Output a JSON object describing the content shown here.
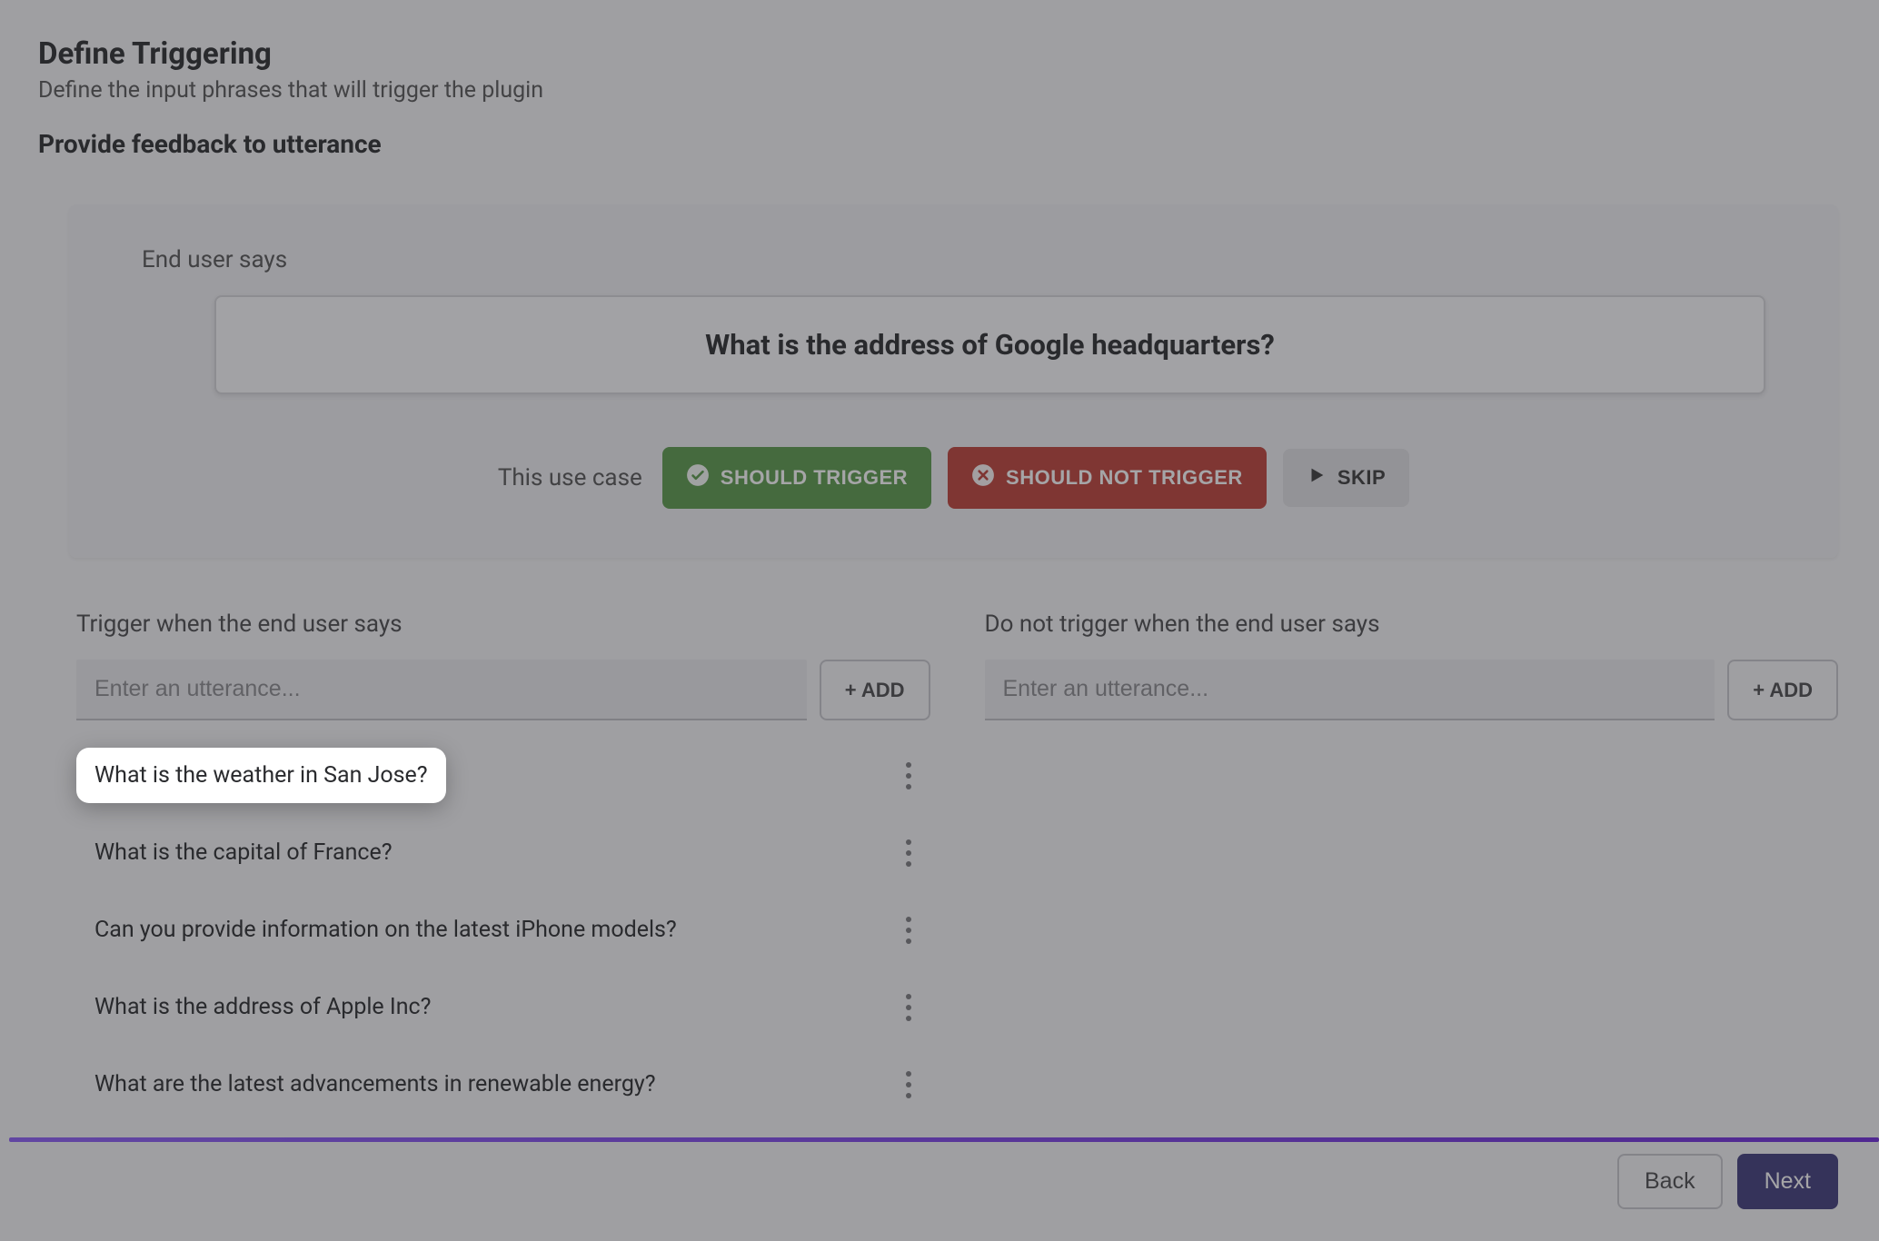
{
  "header": {
    "title": "Define Triggering",
    "subtitle": "Define the input phrases that will trigger the plugin"
  },
  "section_heading": "Provide feedback to utterance",
  "feedback": {
    "end_user_label": "End user says",
    "question": "What is the address of Google headquarters?",
    "verdict_prompt": "This use case",
    "should_trigger_label": "SHOULD TRIGGER",
    "should_not_trigger_label": "SHOULD NOT TRIGGER",
    "skip_label": "SKIP"
  },
  "trigger": {
    "heading": "Trigger when the end user says",
    "placeholder": "Enter an utterance...",
    "add_label": "+ ADD",
    "items": [
      {
        "text": "What is the weather in San Jose?",
        "highlighted": true
      },
      {
        "text": "What is the capital of France?",
        "highlighted": false
      },
      {
        "text": "Can you provide information on the latest iPhone models?",
        "highlighted": false
      },
      {
        "text": "What is the address of Apple Inc?",
        "highlighted": false
      },
      {
        "text": "What are the latest advancements in renewable energy?",
        "highlighted": false
      }
    ]
  },
  "do_not_trigger": {
    "heading": "Do not trigger when the end user says",
    "placeholder": "Enter an utterance...",
    "add_label": "+ ADD",
    "items": []
  },
  "footer": {
    "back_label": "Back",
    "next_label": "Next"
  }
}
